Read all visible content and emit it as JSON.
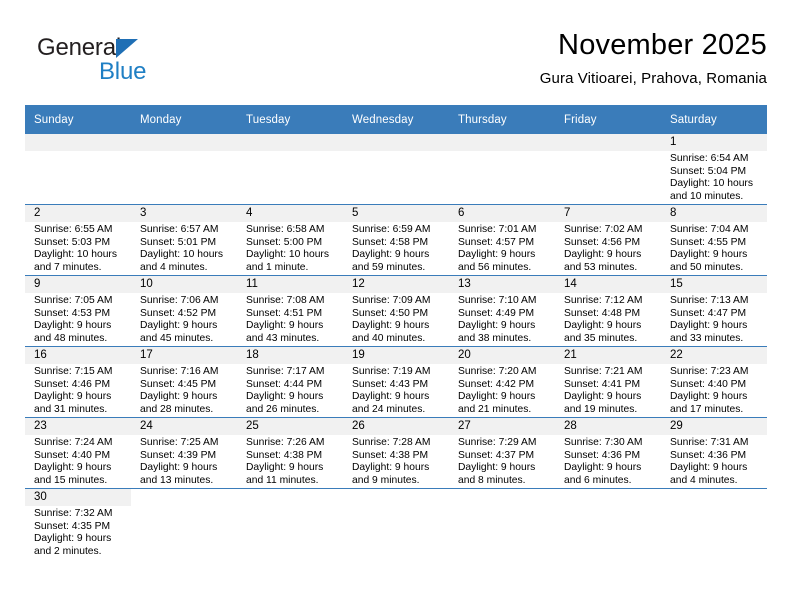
{
  "brand": {
    "word_one": "General",
    "word_two": "Blue",
    "color_black": "#231f20",
    "color_blue": "#1f7fc4"
  },
  "header": {
    "title": "November 2025",
    "subtitle": "Gura Vitioarei, Prahova, Romania"
  },
  "theme": {
    "header_row_bg": "#3a7cba",
    "header_row_text": "#ffffff",
    "daynum_band_bg": "#f1f1f1",
    "row_divider": "#3a7cba"
  },
  "labels": {
    "sunrise": "Sunrise:",
    "sunset": "Sunset:",
    "daylight": "Daylight:"
  },
  "weekday_headers": [
    "Sunday",
    "Monday",
    "Tuesday",
    "Wednesday",
    "Thursday",
    "Friday",
    "Saturday"
  ],
  "weeks": [
    [
      {
        "day": "",
        "blank": true
      },
      {
        "day": "",
        "blank": true
      },
      {
        "day": "",
        "blank": true
      },
      {
        "day": "",
        "blank": true
      },
      {
        "day": "",
        "blank": true
      },
      {
        "day": "",
        "blank": true
      },
      {
        "day": "1",
        "sunrise": "Sunrise: 6:54 AM",
        "sunset": "Sunset: 5:04 PM",
        "daylight_line1": "Daylight: 10 hours",
        "daylight_line2": "and 10 minutes."
      }
    ],
    [
      {
        "day": "2",
        "sunrise": "Sunrise: 6:55 AM",
        "sunset": "Sunset: 5:03 PM",
        "daylight_line1": "Daylight: 10 hours",
        "daylight_line2": "and 7 minutes."
      },
      {
        "day": "3",
        "sunrise": "Sunrise: 6:57 AM",
        "sunset": "Sunset: 5:01 PM",
        "daylight_line1": "Daylight: 10 hours",
        "daylight_line2": "and 4 minutes."
      },
      {
        "day": "4",
        "sunrise": "Sunrise: 6:58 AM",
        "sunset": "Sunset: 5:00 PM",
        "daylight_line1": "Daylight: 10 hours",
        "daylight_line2": "and 1 minute."
      },
      {
        "day": "5",
        "sunrise": "Sunrise: 6:59 AM",
        "sunset": "Sunset: 4:58 PM",
        "daylight_line1": "Daylight: 9 hours",
        "daylight_line2": "and 59 minutes."
      },
      {
        "day": "6",
        "sunrise": "Sunrise: 7:01 AM",
        "sunset": "Sunset: 4:57 PM",
        "daylight_line1": "Daylight: 9 hours",
        "daylight_line2": "and 56 minutes."
      },
      {
        "day": "7",
        "sunrise": "Sunrise: 7:02 AM",
        "sunset": "Sunset: 4:56 PM",
        "daylight_line1": "Daylight: 9 hours",
        "daylight_line2": "and 53 minutes."
      },
      {
        "day": "8",
        "sunrise": "Sunrise: 7:04 AM",
        "sunset": "Sunset: 4:55 PM",
        "daylight_line1": "Daylight: 9 hours",
        "daylight_line2": "and 50 minutes."
      }
    ],
    [
      {
        "day": "9",
        "sunrise": "Sunrise: 7:05 AM",
        "sunset": "Sunset: 4:53 PM",
        "daylight_line1": "Daylight: 9 hours",
        "daylight_line2": "and 48 minutes."
      },
      {
        "day": "10",
        "sunrise": "Sunrise: 7:06 AM",
        "sunset": "Sunset: 4:52 PM",
        "daylight_line1": "Daylight: 9 hours",
        "daylight_line2": "and 45 minutes."
      },
      {
        "day": "11",
        "sunrise": "Sunrise: 7:08 AM",
        "sunset": "Sunset: 4:51 PM",
        "daylight_line1": "Daylight: 9 hours",
        "daylight_line2": "and 43 minutes."
      },
      {
        "day": "12",
        "sunrise": "Sunrise: 7:09 AM",
        "sunset": "Sunset: 4:50 PM",
        "daylight_line1": "Daylight: 9 hours",
        "daylight_line2": "and 40 minutes."
      },
      {
        "day": "13",
        "sunrise": "Sunrise: 7:10 AM",
        "sunset": "Sunset: 4:49 PM",
        "daylight_line1": "Daylight: 9 hours",
        "daylight_line2": "and 38 minutes."
      },
      {
        "day": "14",
        "sunrise": "Sunrise: 7:12 AM",
        "sunset": "Sunset: 4:48 PM",
        "daylight_line1": "Daylight: 9 hours",
        "daylight_line2": "and 35 minutes."
      },
      {
        "day": "15",
        "sunrise": "Sunrise: 7:13 AM",
        "sunset": "Sunset: 4:47 PM",
        "daylight_line1": "Daylight: 9 hours",
        "daylight_line2": "and 33 minutes."
      }
    ],
    [
      {
        "day": "16",
        "sunrise": "Sunrise: 7:15 AM",
        "sunset": "Sunset: 4:46 PM",
        "daylight_line1": "Daylight: 9 hours",
        "daylight_line2": "and 31 minutes."
      },
      {
        "day": "17",
        "sunrise": "Sunrise: 7:16 AM",
        "sunset": "Sunset: 4:45 PM",
        "daylight_line1": "Daylight: 9 hours",
        "daylight_line2": "and 28 minutes."
      },
      {
        "day": "18",
        "sunrise": "Sunrise: 7:17 AM",
        "sunset": "Sunset: 4:44 PM",
        "daylight_line1": "Daylight: 9 hours",
        "daylight_line2": "and 26 minutes."
      },
      {
        "day": "19",
        "sunrise": "Sunrise: 7:19 AM",
        "sunset": "Sunset: 4:43 PM",
        "daylight_line1": "Daylight: 9 hours",
        "daylight_line2": "and 24 minutes."
      },
      {
        "day": "20",
        "sunrise": "Sunrise: 7:20 AM",
        "sunset": "Sunset: 4:42 PM",
        "daylight_line1": "Daylight: 9 hours",
        "daylight_line2": "and 21 minutes."
      },
      {
        "day": "21",
        "sunrise": "Sunrise: 7:21 AM",
        "sunset": "Sunset: 4:41 PM",
        "daylight_line1": "Daylight: 9 hours",
        "daylight_line2": "and 19 minutes."
      },
      {
        "day": "22",
        "sunrise": "Sunrise: 7:23 AM",
        "sunset": "Sunset: 4:40 PM",
        "daylight_line1": "Daylight: 9 hours",
        "daylight_line2": "and 17 minutes."
      }
    ],
    [
      {
        "day": "23",
        "sunrise": "Sunrise: 7:24 AM",
        "sunset": "Sunset: 4:40 PM",
        "daylight_line1": "Daylight: 9 hours",
        "daylight_line2": "and 15 minutes."
      },
      {
        "day": "24",
        "sunrise": "Sunrise: 7:25 AM",
        "sunset": "Sunset: 4:39 PM",
        "daylight_line1": "Daylight: 9 hours",
        "daylight_line2": "and 13 minutes."
      },
      {
        "day": "25",
        "sunrise": "Sunrise: 7:26 AM",
        "sunset": "Sunset: 4:38 PM",
        "daylight_line1": "Daylight: 9 hours",
        "daylight_line2": "and 11 minutes."
      },
      {
        "day": "26",
        "sunrise": "Sunrise: 7:28 AM",
        "sunset": "Sunset: 4:38 PM",
        "daylight_line1": "Daylight: 9 hours",
        "daylight_line2": "and 9 minutes."
      },
      {
        "day": "27",
        "sunrise": "Sunrise: 7:29 AM",
        "sunset": "Sunset: 4:37 PM",
        "daylight_line1": "Daylight: 9 hours",
        "daylight_line2": "and 8 minutes."
      },
      {
        "day": "28",
        "sunrise": "Sunrise: 7:30 AM",
        "sunset": "Sunset: 4:36 PM",
        "daylight_line1": "Daylight: 9 hours",
        "daylight_line2": "and 6 minutes."
      },
      {
        "day": "29",
        "sunrise": "Sunrise: 7:31 AM",
        "sunset": "Sunset: 4:36 PM",
        "daylight_line1": "Daylight: 9 hours",
        "daylight_line2": "and 4 minutes."
      }
    ],
    [
      {
        "day": "30",
        "sunrise": "Sunrise: 7:32 AM",
        "sunset": "Sunset: 4:35 PM",
        "daylight_line1": "Daylight: 9 hours",
        "daylight_line2": "and 2 minutes."
      },
      {
        "day": "",
        "blank": true
      },
      {
        "day": "",
        "blank": true
      },
      {
        "day": "",
        "blank": true
      },
      {
        "day": "",
        "blank": true
      },
      {
        "day": "",
        "blank": true
      },
      {
        "day": "",
        "blank": true
      }
    ]
  ]
}
